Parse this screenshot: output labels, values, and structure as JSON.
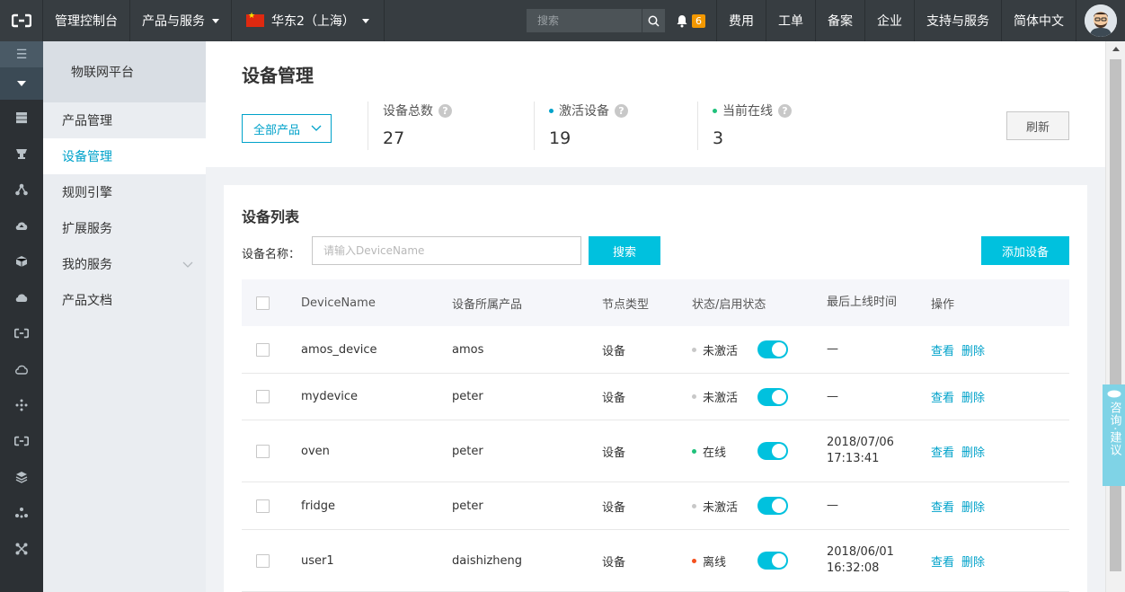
{
  "topbar": {
    "console_label": "管理控制台",
    "products_label": "产品与服务",
    "region_label": "华东2（上海）",
    "search_placeholder": "搜索",
    "notification_count": "6",
    "nav": [
      "费用",
      "工单",
      "备案",
      "企业",
      "支持与服务",
      "简体中文"
    ]
  },
  "subnav": {
    "title": "物联网平台",
    "items": [
      {
        "label": "产品管理"
      },
      {
        "label": "设备管理"
      },
      {
        "label": "规则引擎"
      },
      {
        "label": "扩展服务"
      },
      {
        "label": "我的服务"
      },
      {
        "label": "产品文档"
      }
    ],
    "active_index": 1
  },
  "header": {
    "title": "设备管理",
    "product_select": "全部产品",
    "refresh_label": "刷新",
    "stats": [
      {
        "label": "设备总数",
        "value": "27",
        "dot_color": ""
      },
      {
        "label": "激活设备",
        "value": "19",
        "dot_color": "#00a2ca"
      },
      {
        "label": "当前在线",
        "value": "3",
        "dot_color": "#1fc17b"
      }
    ]
  },
  "device_list": {
    "title": "设备列表",
    "filter_label": "设备名称：",
    "filter_placeholder": "请输入DeviceName",
    "search_label": "搜索",
    "add_label": "添加设备",
    "columns": [
      "DeviceName",
      "设备所属产品",
      "节点类型",
      "状态/启用状态",
      "最后上线时间",
      "操作"
    ],
    "view_label": "查看",
    "delete_label": "删除",
    "rows": [
      {
        "name": "amos_device",
        "product": "amos",
        "node_type": "设备",
        "status": "未激活",
        "status_color": "#c8c8c8",
        "last_online": [
          "—"
        ]
      },
      {
        "name": "mydevice",
        "product": "peter",
        "node_type": "设备",
        "status": "未激活",
        "status_color": "#c8c8c8",
        "last_online": [
          "—"
        ]
      },
      {
        "name": "oven",
        "product": "peter",
        "node_type": "设备",
        "status": "在线",
        "status_color": "#1fc17b",
        "last_online": [
          "2018/07/06",
          "17:13:41"
        ]
      },
      {
        "name": "fridge",
        "product": "peter",
        "node_type": "设备",
        "status": "未激活",
        "status_color": "#c8c8c8",
        "last_online": [
          "—"
        ]
      },
      {
        "name": "user1",
        "product": "daishizheng",
        "node_type": "设备",
        "status": "离线",
        "status_color": "#f4511e",
        "last_online": [
          "2018/06/01",
          "16:32:08"
        ]
      }
    ]
  },
  "float_consult": "咨询·建议",
  "colors": {
    "accent": "#00c1de",
    "link": "#00a2ca",
    "topbar": "#373d41"
  }
}
